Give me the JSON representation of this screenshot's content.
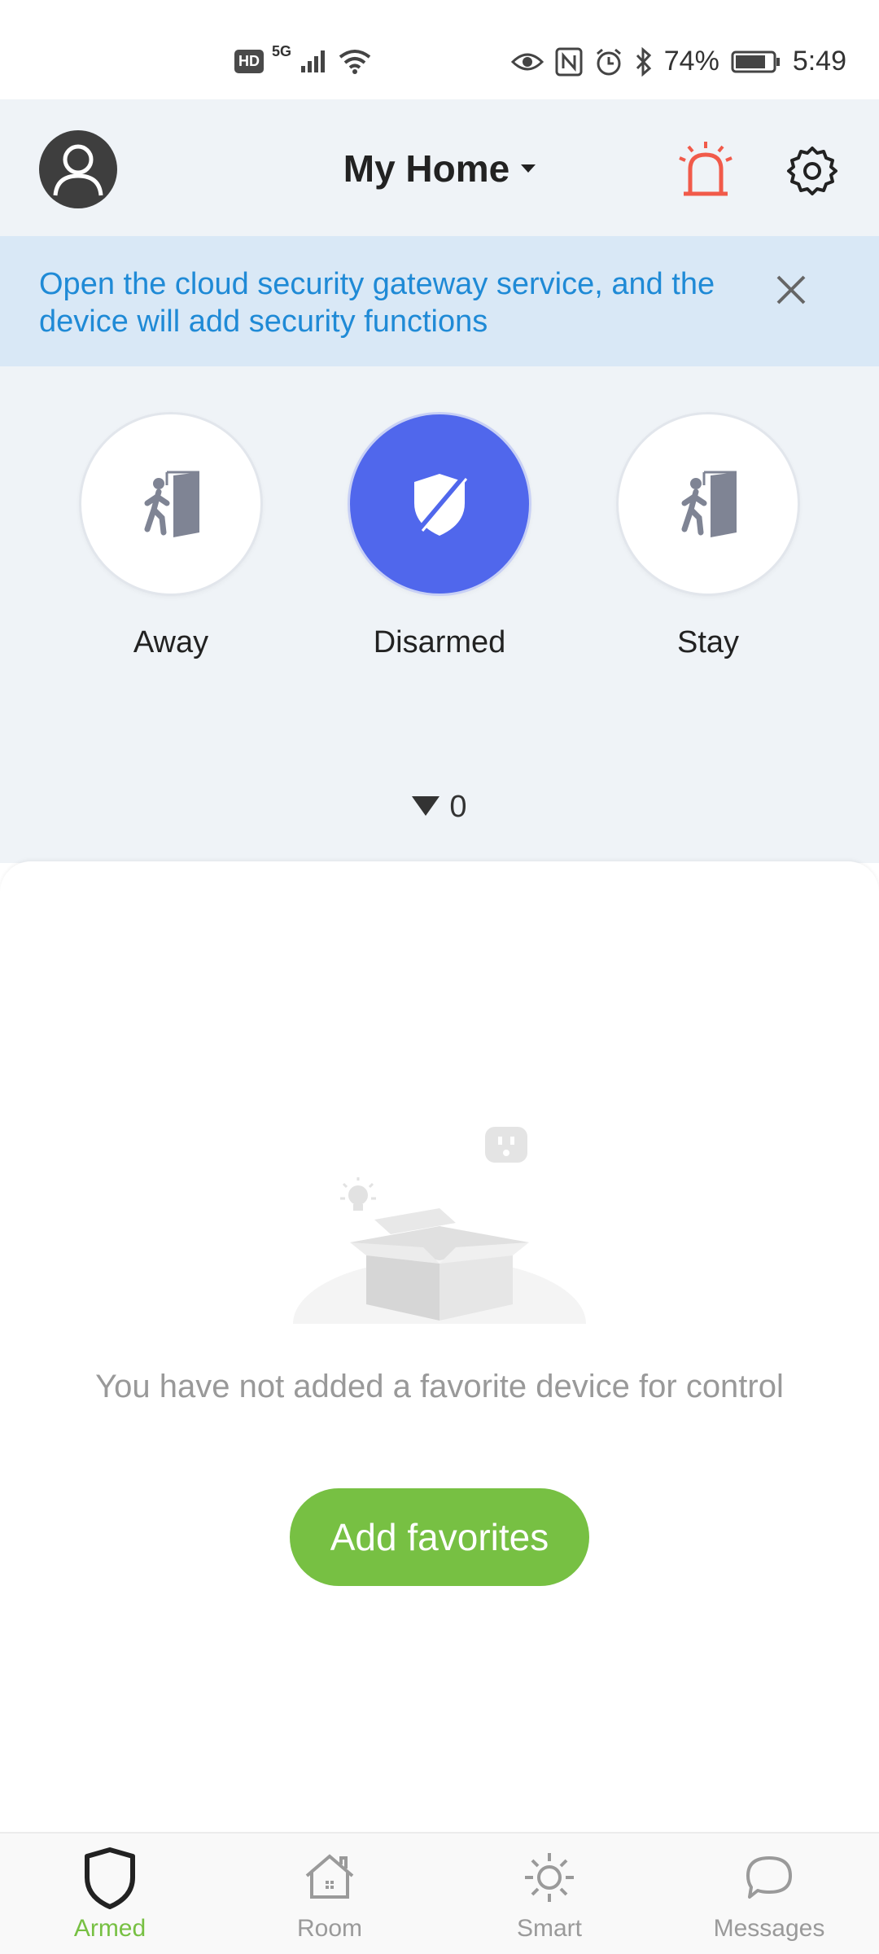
{
  "status_bar": {
    "hd_label": "HD",
    "network_label": "5G",
    "battery_percent": "74%",
    "time": "5:49"
  },
  "header": {
    "title": "My Home",
    "avatar_icon": "user-avatar-icon",
    "alarm_icon": "siren-icon",
    "settings_icon": "gear-icon",
    "alarm_color": "#f15a4a"
  },
  "banner": {
    "text": "Open the cloud security gateway service, and the device will add security functions",
    "close_icon": "close-icon"
  },
  "modes": [
    {
      "label": "Away",
      "icon": "person-exit-door-icon",
      "active": false
    },
    {
      "label": "Disarmed",
      "icon": "shield-disarmed-icon",
      "active": true
    },
    {
      "label": "Stay",
      "icon": "person-exit-door-icon",
      "active": false
    }
  ],
  "counter": {
    "value": "0",
    "icon": "triangle-down-icon"
  },
  "empty_state": {
    "message": "You have not added a favorite device for control",
    "button_label": "Add favorites",
    "button_color": "#77c043"
  },
  "bottom_nav": [
    {
      "label": "Armed",
      "icon": "shield-icon",
      "active": true
    },
    {
      "label": "Room",
      "icon": "house-icon",
      "active": false
    },
    {
      "label": "Smart",
      "icon": "sun-icon",
      "active": false
    },
    {
      "label": "Messages",
      "icon": "chat-bubble-icon",
      "active": false
    }
  ],
  "colors": {
    "accent_green": "#77c043",
    "mode_active_blue": "#5067ec",
    "banner_text_blue": "#1f8ad6",
    "header_bg": "#eff3f7"
  }
}
